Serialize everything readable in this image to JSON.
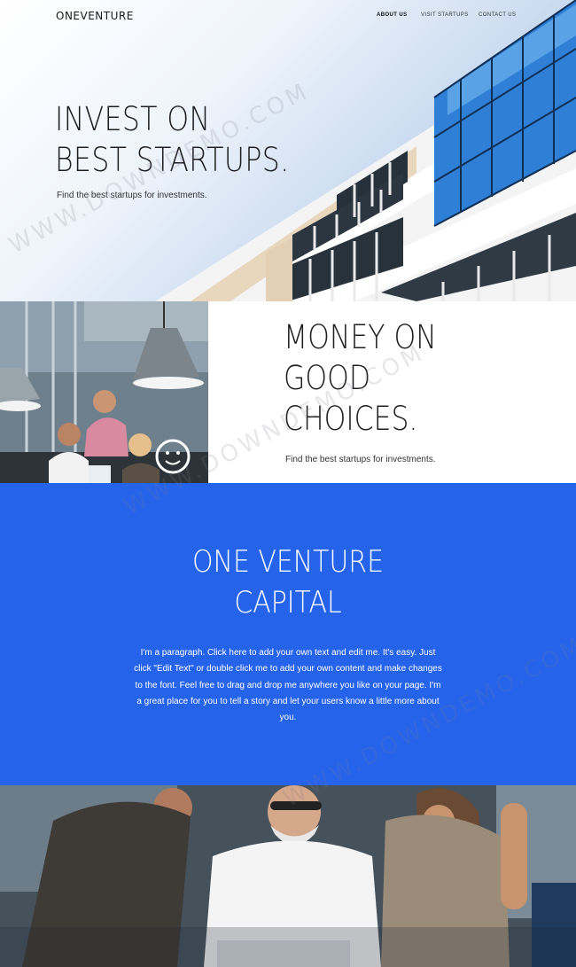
{
  "brand": "ONEVENTURE",
  "nav": [
    {
      "label": "ABOUT US",
      "active": true
    },
    {
      "label": "VISIT STARTUPS",
      "active": false
    },
    {
      "label": "CONTACT US",
      "active": false
    }
  ],
  "hero": {
    "title_line1": "INVEST ON",
    "title_line2": "BEST STARTUPS.",
    "subtitle": "Find the best startups for investments."
  },
  "section2": {
    "title_line1": "MONEY ON",
    "title_line2": "GOOD",
    "title_line3": "CHOICES.",
    "subtitle": "Find the best startups for investments."
  },
  "capital": {
    "title_line1": "ONE VENTURE",
    "title_line2": "CAPITAL",
    "paragraph": "I'm a paragraph. Click here to add your own text and edit me. It's easy. Just click \"Edit Text\" or double click me to add your own content and make changes to the font. Feel free to drag and drop me anywhere you like on your page. I'm a great place for you to tell a story and let your users know a little more about you."
  },
  "watermark": "WWW.DOWNDEMO.COM",
  "colors": {
    "accent_blue": "#2563eb",
    "glass_blue": "#2f7fd6"
  }
}
